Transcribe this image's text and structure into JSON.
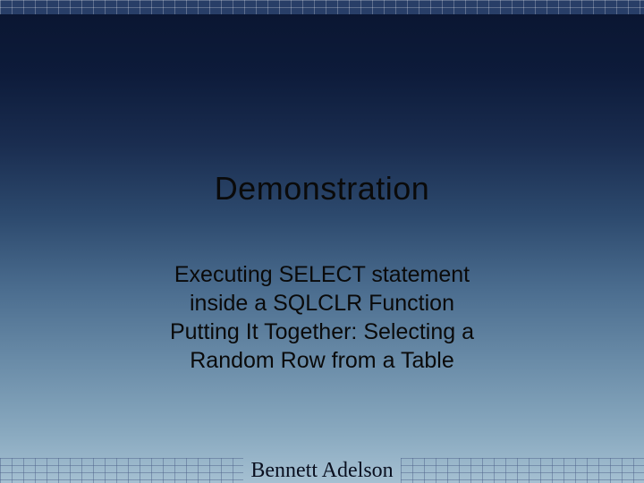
{
  "slide": {
    "title": "Demonstration",
    "body_line1": "Executing SELECT statement",
    "body_line2": "inside a SQLCLR Function",
    "body_line3": "Putting It Together: Selecting a",
    "body_line4": "Random Row from a Table",
    "footer": "Bennett Adelson"
  }
}
